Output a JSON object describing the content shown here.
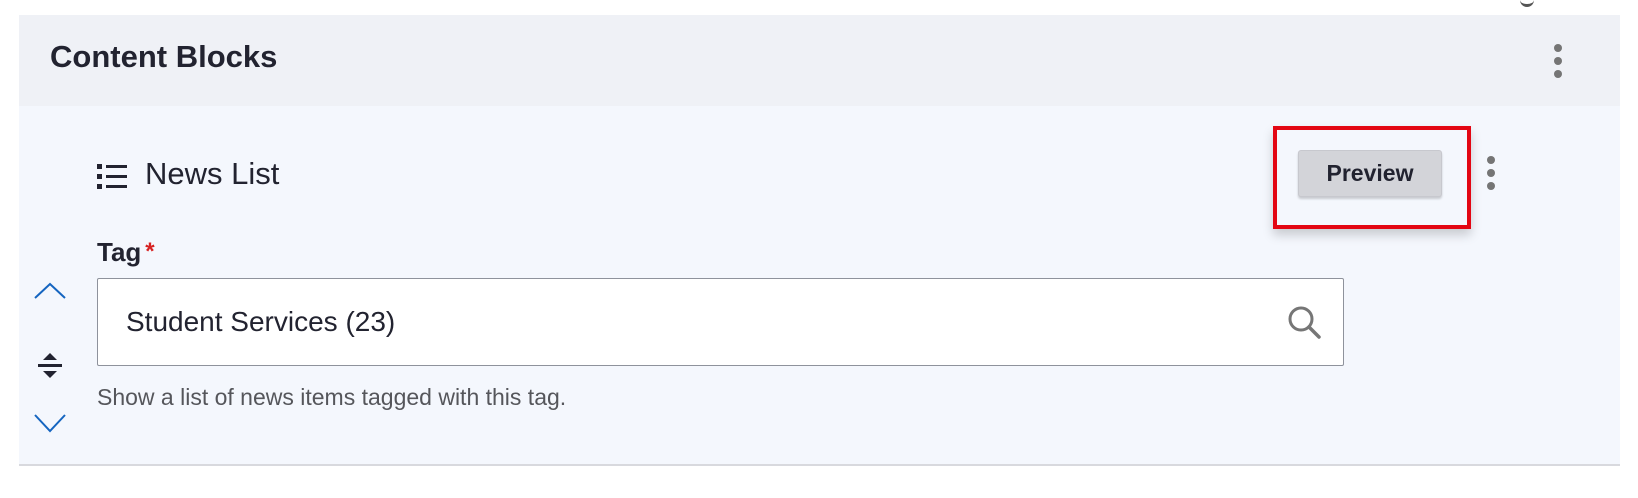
{
  "panel": {
    "title": "Content Blocks",
    "menu_icon": "kebab-icon"
  },
  "block": {
    "type_icon": "list-icon",
    "title": "News List",
    "preview_label": "Preview",
    "menu_icon": "kebab-icon",
    "reorder": {
      "up_icon": "chevron-up-icon",
      "handle_icon": "drag-handle-icon",
      "down_icon": "chevron-down-icon"
    },
    "field": {
      "label": "Tag",
      "required_mark": "*",
      "value": "Student Services (23)",
      "search_icon": "search-icon",
      "description": "Show a list of news items tagged with this tag."
    }
  },
  "colors": {
    "accent_blue": "#1565c0",
    "required_red": "#d72222",
    "highlight_red": "#e30613",
    "header_bg": "#eff1f6",
    "body_bg": "#f4f7fd"
  }
}
